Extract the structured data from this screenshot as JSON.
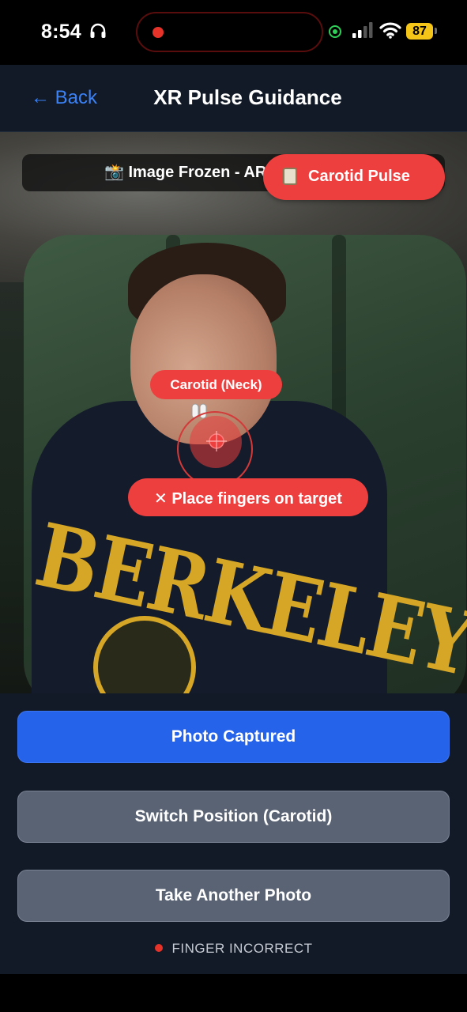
{
  "status_bar": {
    "time": "8:54",
    "battery": "87",
    "icons": [
      "headphones-icon",
      "recording-dot-icon",
      "camera-in-use-icon",
      "signal-icon",
      "wifi-icon",
      "battery-icon"
    ]
  },
  "header": {
    "back_label": "← Back",
    "title": "XR Pulse Guidance"
  },
  "camera": {
    "frozen_banner": "📸 Image Frozen - AR",
    "pulse_badge": "Carotid Pulse",
    "target_label": "Carotid (Neck)",
    "warning": "✕ Place fingers on target"
  },
  "actions": {
    "photo_captured": "Photo Captured",
    "switch_position": "Switch Position (Carotid)",
    "take_another": "Take Another Photo"
  },
  "status": {
    "text": "FINGER INCORRECT",
    "color": "#e5332a"
  },
  "colors": {
    "accent_blue": "#2563eb",
    "alert_red": "#ee3f3f",
    "panel_bg": "#121a27"
  }
}
